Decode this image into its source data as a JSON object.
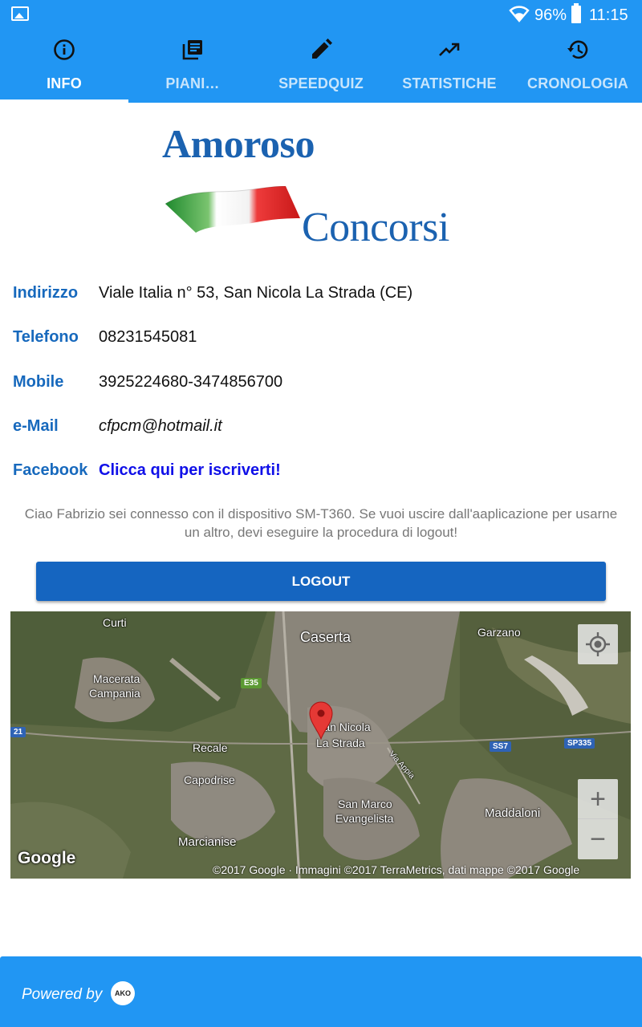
{
  "status_bar": {
    "battery": "96%",
    "time": "11:15"
  },
  "tabs": [
    {
      "label": "INFO",
      "icon": "info-icon",
      "active": true
    },
    {
      "label": "PIANI…",
      "icon": "library-books-icon",
      "active": false
    },
    {
      "label": "SPEEDQUIZ",
      "icon": "pencil-icon",
      "active": false
    },
    {
      "label": "STATISTICHE",
      "icon": "trending-up-icon",
      "active": false
    },
    {
      "label": "CRONOLOGIA",
      "icon": "history-icon",
      "active": false
    }
  ],
  "logo": {
    "line1": "Amoroso",
    "line2": "Concorsi"
  },
  "contact": {
    "address_label": "Indirizzo",
    "address": "Viale Italia n° 53, San Nicola La Strada (CE)",
    "phone_label": "Telefono",
    "phone": "08231545081",
    "mobile_label": "Mobile",
    "mobile": "3925224680-3474856700",
    "email_label": "e-Mail",
    "email": "cfpcm@hotmail.it",
    "facebook_label": "Facebook",
    "facebook_link": "Clicca qui per iscriverti!"
  },
  "notice": "Ciao Fabrizio sei connesso con il dispositivo SM-T360. Se vuoi uscire dall'aaplicazione per usarne un altro, devi eseguire la procedura di logout!",
  "logout_label": "LOGOUT",
  "map": {
    "places": {
      "curti": "Curti",
      "caserta": "Caserta",
      "garzano": "Garzano",
      "macerata_1": "Macerata",
      "macerata_2": "Campania",
      "san_nicola_1": "San Nicola",
      "san_nicola_2": "La Strada",
      "recale": "Recale",
      "capodrise": "Capodrise",
      "via_appia": "Via Appia",
      "san_marco_1": "San Marco",
      "san_marco_2": "Evangelista",
      "maddaloni": "Maddaloni",
      "marcianise": "Marcianise"
    },
    "shields": {
      "e35": "E35",
      "ss7": "SS7",
      "sp335": "SP335",
      "r21": "21"
    },
    "google": "Google",
    "attribution": "©2017 Google · Immagini ©2017 TerraMetrics, dati mappe ©2017 Google",
    "zoom_in": "+",
    "zoom_out": "−"
  },
  "footer": {
    "powered_by": "Powered by",
    "badge": "AKO"
  }
}
